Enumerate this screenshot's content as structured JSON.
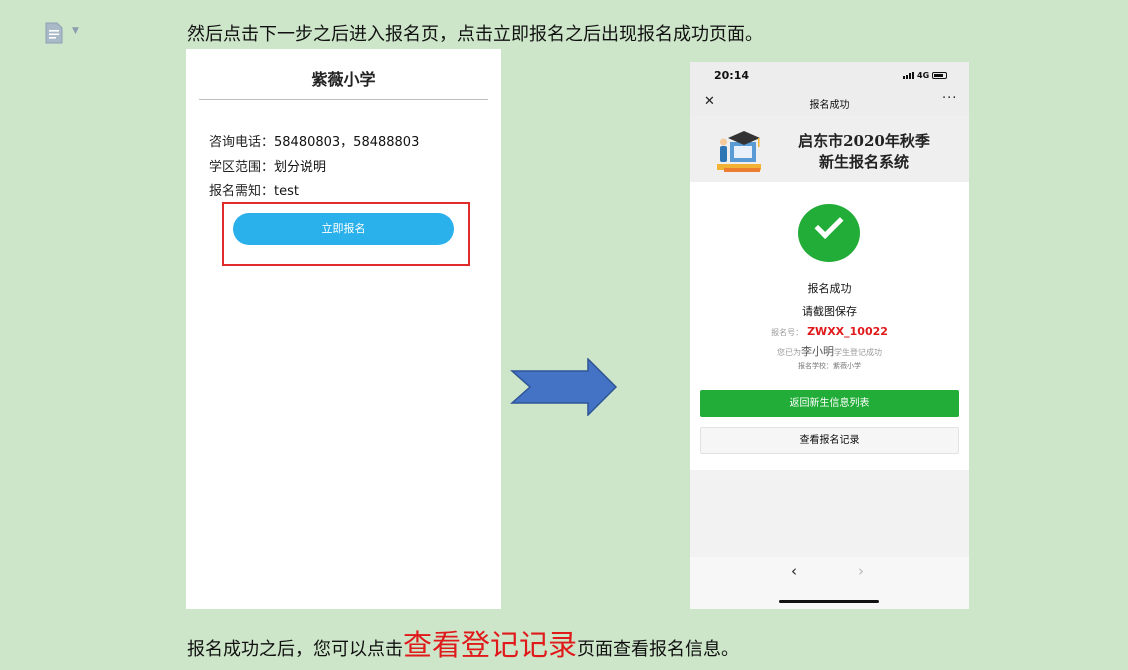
{
  "doc": {
    "para_top": "然后点击下一步之后进入报名页，点击立即报名之后出现报名成功页面。",
    "para_bottom_before": "报名成功之后，您可以点击",
    "para_bottom_highlight": "查看登记记录",
    "para_bottom_after": "页面查看报名信息。",
    "highlight_color": "#e0191b",
    "background_color": "#cde6c9"
  },
  "left_screen": {
    "school_title": "紫薇小学",
    "phone_label": "咨询电话：",
    "phone_value": "58480803，58488803",
    "district_label": "学区范围：",
    "district_value": "划分说明",
    "notice_label": "报名需知：",
    "notice_value": "test",
    "enroll_button": "立即报名",
    "button_color": "#2ab0ea"
  },
  "arrow": {
    "icon": "right-arrow-icon",
    "color": "#4472c4"
  },
  "right_screen": {
    "status_time": "20:14",
    "network": "4G",
    "nav_title": "报名成功",
    "nav_close": "✕",
    "nav_more": "···",
    "banner_line1": "启东市2020年秋季",
    "banner_line2": "新生报名系统",
    "success_text": "报名成功",
    "save_hint": "请截图保存",
    "reg_no_label": "报名号：",
    "reg_no_value": "ZWXX_10022",
    "student_prefix": "您已为",
    "student_name": "李小明",
    "student_suffix": "学生登记成功",
    "school_label": "报名学校：",
    "school_value": "紫薇小学",
    "btn_return": "返回新生信息列表",
    "btn_records": "查看报名记录",
    "nav_back": "‹",
    "nav_forward": "›",
    "success_color": "#22ac38"
  }
}
